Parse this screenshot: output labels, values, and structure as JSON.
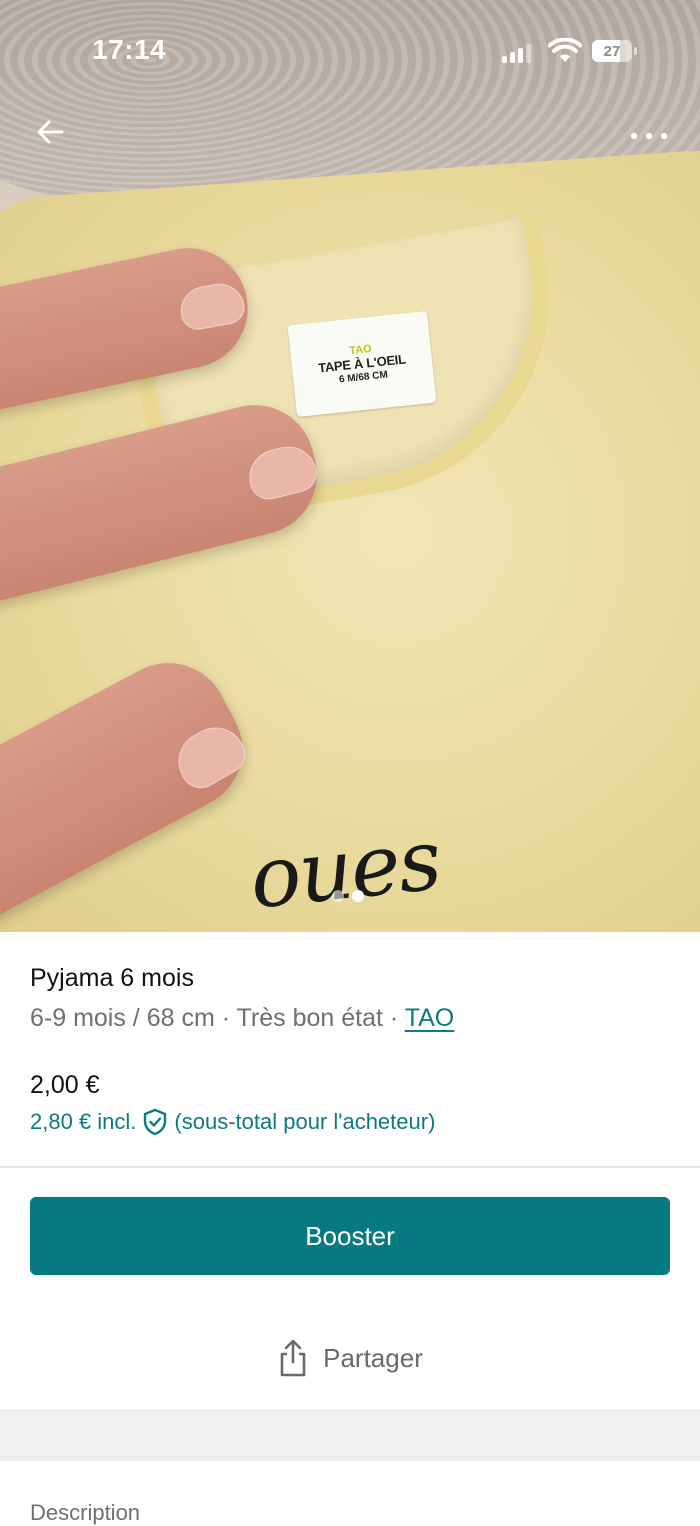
{
  "status_bar": {
    "time": "17:14",
    "battery": "27"
  },
  "photo": {
    "tag_brand": "TAO",
    "tag_name": "TAPE À L'OEIL",
    "tag_size": "6 M/68 CM",
    "printed_text": "oues",
    "carousel_total": 2,
    "carousel_active_index": 1
  },
  "header": {
    "back_icon": "arrow-left-icon",
    "more_icon": "more-horizontal-icon"
  },
  "item": {
    "title": "Pyjama 6 mois",
    "size": "6-9 mois / 68 cm",
    "separator": " · ",
    "condition": "Très bon état",
    "brand": "TAO",
    "price": "2,00 €",
    "price_incl": "2,80 € incl.",
    "price_incl_note": "(sous-total pour l'acheteur)"
  },
  "actions": {
    "booster_label": "Booster",
    "share_label": "Partager",
    "share_icon": "share-icon",
    "protection_icon": "shield-check-icon"
  },
  "description": {
    "label": "Description"
  },
  "colors": {
    "accent": "#067a80",
    "link": "#0d7a80",
    "muted_text": "#707070"
  }
}
